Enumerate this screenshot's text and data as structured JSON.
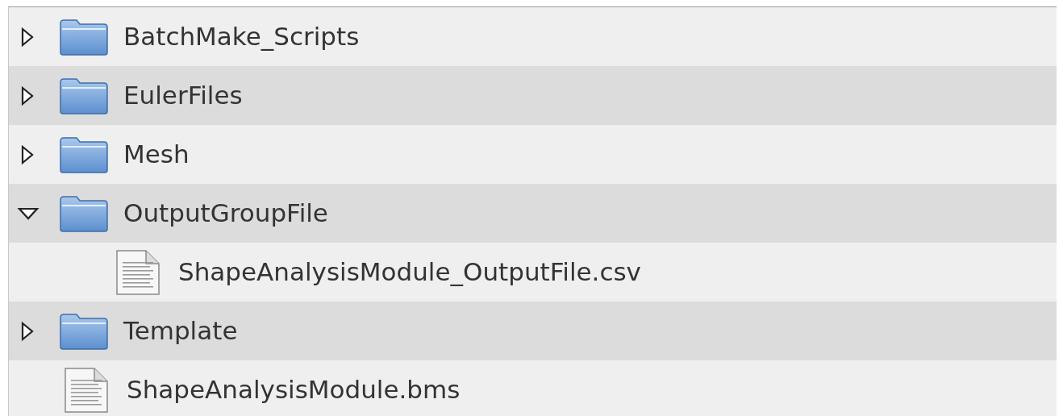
{
  "tree": [
    {
      "kind": "folder",
      "label": "BatchMake_Scripts",
      "expanded": false
    },
    {
      "kind": "folder",
      "label": "EulerFiles",
      "expanded": false
    },
    {
      "kind": "folder",
      "label": "Mesh",
      "expanded": false
    },
    {
      "kind": "folder",
      "label": "OutputGroupFile",
      "expanded": true,
      "children": [
        {
          "kind": "file",
          "label": "ShapeAnalysisModule_OutputFile.csv"
        }
      ]
    },
    {
      "kind": "folder",
      "label": "Template",
      "expanded": false
    },
    {
      "kind": "file",
      "label": "ShapeAnalysisModule.bms"
    }
  ]
}
